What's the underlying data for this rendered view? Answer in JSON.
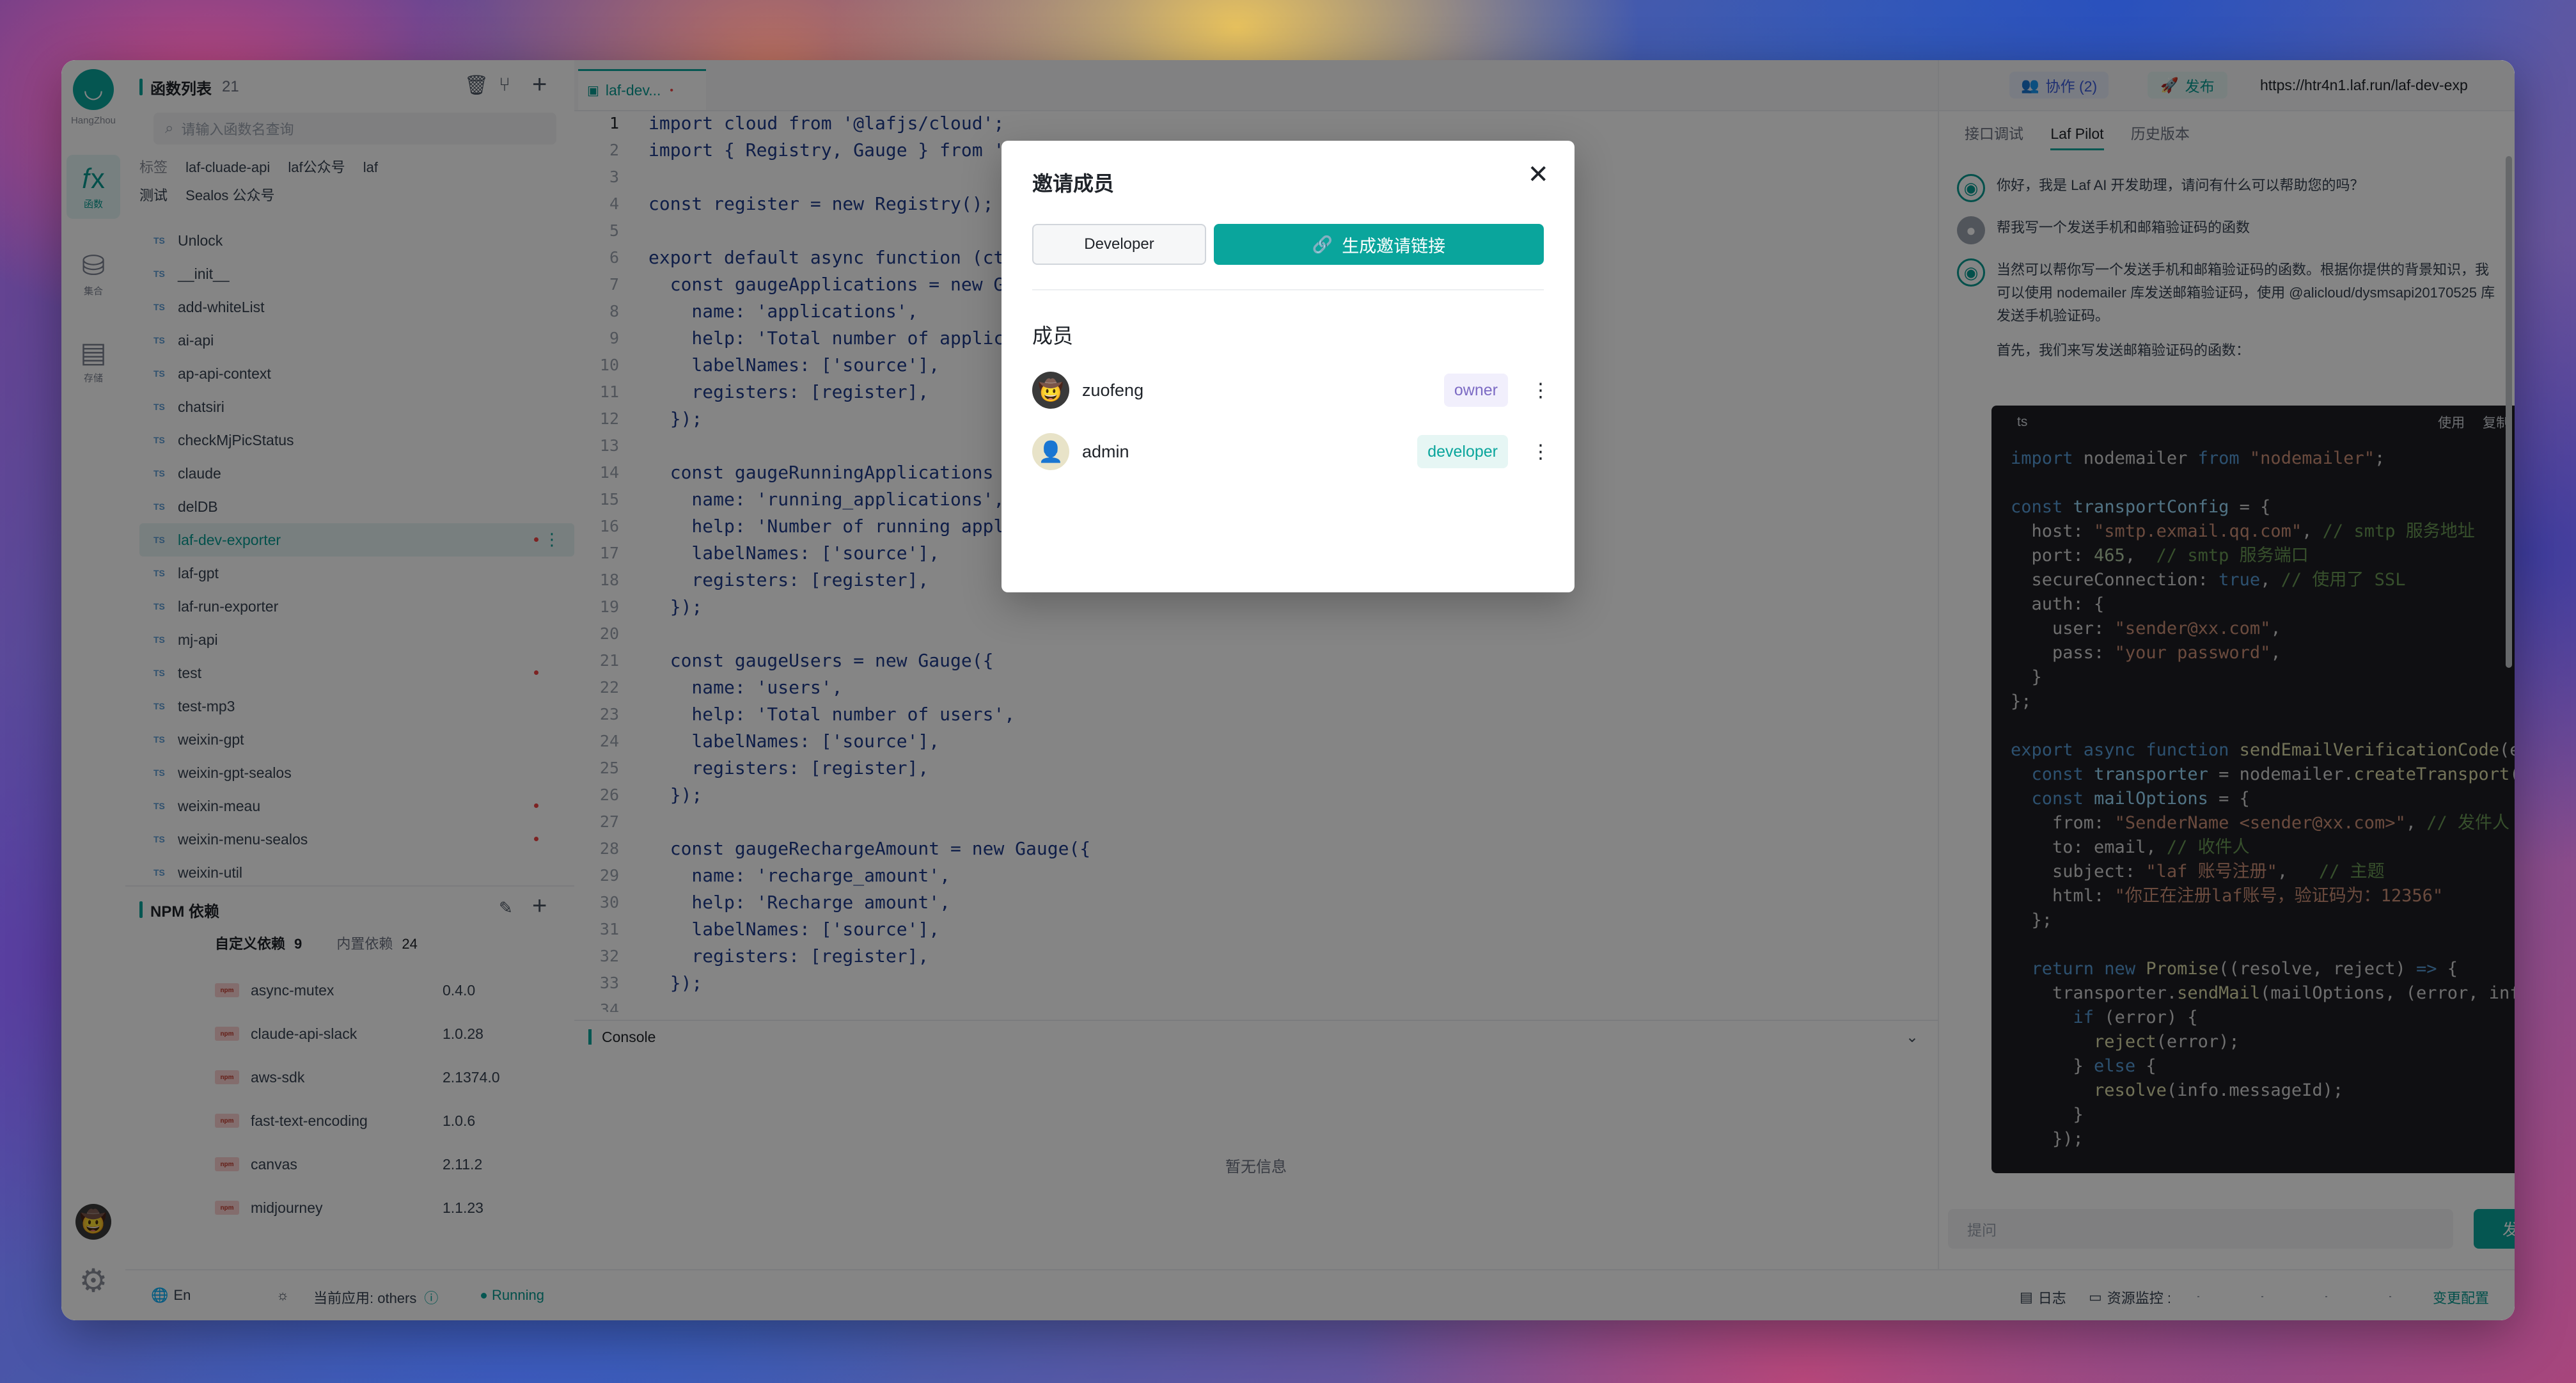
{
  "rail": {
    "region": "HangZhou",
    "items": [
      {
        "icon": "fx-icon",
        "glyph": "𝑓x",
        "label": "函数"
      },
      {
        "icon": "database-icon",
        "glyph": "⛁",
        "label": "集合"
      },
      {
        "icon": "storage-icon",
        "glyph": "▤",
        "label": "存储"
      }
    ]
  },
  "functions": {
    "title": "函数列表",
    "count": "21",
    "search_placeholder": "请输入函数名查询",
    "tag_label": "标签",
    "tags": [
      "laf-cluade-api",
      "laf公众号",
      "laf",
      "测试",
      "Sealos 公众号"
    ],
    "items": [
      {
        "name": "Unlock"
      },
      {
        "name": "__init__"
      },
      {
        "name": "add-whiteList"
      },
      {
        "name": "ai-api"
      },
      {
        "name": "ap-api-context"
      },
      {
        "name": "chatsiri"
      },
      {
        "name": "checkMjPicStatus"
      },
      {
        "name": "claude"
      },
      {
        "name": "delDB"
      },
      {
        "name": "laf-dev-exporter",
        "active": true,
        "modified": true
      },
      {
        "name": "laf-gpt"
      },
      {
        "name": "laf-run-exporter"
      },
      {
        "name": "mj-api"
      },
      {
        "name": "test",
        "modified": true
      },
      {
        "name": "test-mp3"
      },
      {
        "name": "weixin-gpt"
      },
      {
        "name": "weixin-gpt-sealos"
      },
      {
        "name": "weixin-meau",
        "modified": true
      },
      {
        "name": "weixin-menu-sealos",
        "modified": true
      },
      {
        "name": "weixin-util"
      }
    ]
  },
  "npm": {
    "title": "NPM 依赖",
    "tab_custom": "自定义依赖",
    "tab_custom_count": "9",
    "tab_builtin": "内置依赖",
    "tab_builtin_count": "24",
    "items": [
      {
        "name": "async-mutex",
        "version": "0.4.0"
      },
      {
        "name": "claude-api-slack",
        "version": "1.0.28"
      },
      {
        "name": "aws-sdk",
        "version": "2.1374.0"
      },
      {
        "name": "fast-text-encoding",
        "version": "1.0.6"
      },
      {
        "name": "canvas",
        "version": "2.11.2"
      },
      {
        "name": "midjourney",
        "version": "1.1.23"
      }
    ]
  },
  "editor": {
    "tab_label": "laf-dev...",
    "tab_modified": "•",
    "code": [
      "import cloud from '@lafjs/cloud';",
      "import { Registry, Gauge } from 'prom-client';",
      "",
      "const register = new Registry();",
      "",
      "export default async function (ctx: FunctionContext) {",
      "  const gaugeApplications = new Gauge({",
      "    name: 'applications',",
      "    help: 'Total number of applications',",
      "    labelNames: ['source'],",
      "    registers: [register],",
      "  });",
      "",
      "  const gaugeRunningApplications = new Gauge({",
      "    name: 'running_applications',",
      "    help: 'Number of running applications',",
      "    labelNames: ['source'],",
      "    registers: [register],",
      "  });",
      "",
      "  const gaugeUsers = new Gauge({",
      "    name: 'users',",
      "    help: 'Total number of users',",
      "    labelNames: ['source'],",
      "    registers: [register],",
      "  });",
      "",
      "  const gaugeRechargeAmount = new Gauge({",
      "    name: 'recharge_amount',",
      "    help: 'Recharge amount',",
      "    labelNames: ['source'],",
      "    registers: [register],",
      "  });",
      ""
    ]
  },
  "console": {
    "title": "Console",
    "empty": "暂无信息"
  },
  "topbar": {
    "collab": "协作 (2)",
    "publish": "发布",
    "url": "https://htr4n1.laf.run/laf-dev-exp"
  },
  "right": {
    "tabs": [
      "接口调试",
      "Laf Pilot",
      "历史版本"
    ],
    "active_tab": "Laf Pilot",
    "greeting": "你好，我是 Laf AI 开发助理，请问有什么可以帮助您的吗？",
    "user_question": "帮我写一个发送手机和邮箱验证码的函数",
    "answer": "当然可以帮你写一个发送手机和邮箱验证码的函数。根据你提供的背景知识，我可以使用 nodemailer 库发送邮箱验证码，使用 @alicloud/dysmsapi20170525 库发送手机验证码。",
    "answer_first": "首先，我们来写发送邮箱验证码的函数：",
    "code_lang": "ts",
    "code_use": "使用",
    "code_copy": "复制",
    "ask_placeholder": "提问",
    "send": "发送"
  },
  "status": {
    "lang": "En",
    "current_app": "当前应用: others",
    "running": "Running",
    "logs": "日志",
    "monitor": "资源监控 :",
    "change_config": "变更配置"
  },
  "modal": {
    "title": "邀请成员",
    "role": "Developer",
    "generate": "生成邀请链接",
    "members_title": "成员",
    "members": [
      {
        "name": "zuofeng",
        "role": "owner"
      },
      {
        "name": "admin",
        "role": "developer"
      }
    ]
  },
  "colors": {
    "accent": "#0aa59c",
    "owner_badge": "#7c6bc4",
    "modified_dot": "#ef4444"
  }
}
